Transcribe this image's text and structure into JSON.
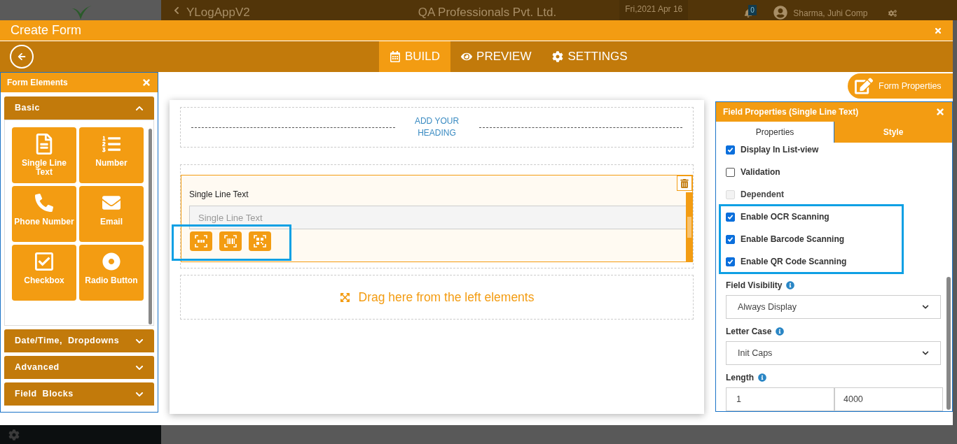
{
  "backdrop": {
    "app_title": "YLogAppV2",
    "company": "QA Professionals Pvt. Ltd.",
    "date": "Fri,2021 Apr 16",
    "notification_count": "0",
    "user": "Sharma, Juhi Comp"
  },
  "modal": {
    "title": "Create Form"
  },
  "tabs": [
    {
      "label": "BUILD",
      "kind": "build",
      "selected": true
    },
    {
      "label": "PREVIEW",
      "kind": "eye",
      "selected": false
    },
    {
      "label": "SETTINGS",
      "kind": "gear",
      "selected": false
    }
  ],
  "elements_panel": {
    "title": "Form Elements",
    "sections": [
      {
        "label": "Basic",
        "expanded": true,
        "items": [
          {
            "label": "Single Line Text",
            "kind": "file"
          },
          {
            "label": "Number",
            "kind": "list"
          },
          {
            "label": "Phone Number",
            "kind": "phone"
          },
          {
            "label": "Email",
            "kind": "mail"
          },
          {
            "label": "Checkbox",
            "kind": "check"
          },
          {
            "label": "Radio Button",
            "kind": "radio"
          }
        ]
      },
      {
        "label": "Date/Time,  Dropdowns",
        "expanded": false
      },
      {
        "label": "Advanced",
        "expanded": false
      },
      {
        "label": "Field  Blocks",
        "expanded": false
      }
    ]
  },
  "canvas": {
    "heading": "ADD YOUR HEADING",
    "field": {
      "label": "Single Line Text",
      "placeholder": "Single Line Text",
      "scanners": [
        {
          "kind": "ocr"
        },
        {
          "kind": "barcode"
        },
        {
          "kind": "qr"
        }
      ]
    },
    "drop_hint": "Drag here from the left elements"
  },
  "form_properties_button": "Form Properties",
  "properties_panel": {
    "title": "Field Properties (Single Line Text)",
    "tabs": [
      {
        "label": "Properties",
        "selected": true
      },
      {
        "label": "Style",
        "selected": false
      }
    ],
    "options": [
      {
        "label": "Display In List-view",
        "checked": true,
        "disabled": false,
        "highlighted": false
      },
      {
        "label": "Validation",
        "checked": false,
        "disabled": false,
        "highlighted": false
      },
      {
        "label": "Dependent",
        "checked": false,
        "disabled": true,
        "highlighted": false
      },
      {
        "label": "Enable OCR Scanning",
        "checked": true,
        "disabled": false,
        "highlighted": true
      },
      {
        "label": "Enable Barcode Scanning",
        "checked": true,
        "disabled": false,
        "highlighted": true
      },
      {
        "label": "Enable QR Code Scanning",
        "checked": true,
        "disabled": false,
        "highlighted": true
      }
    ],
    "field_visibility": {
      "label": "Field Visibility",
      "value": "Always Display"
    },
    "letter_case": {
      "label": "Letter Case",
      "value": "Init Caps"
    },
    "length": {
      "label": "Length",
      "min": "1",
      "max": "4000"
    }
  }
}
